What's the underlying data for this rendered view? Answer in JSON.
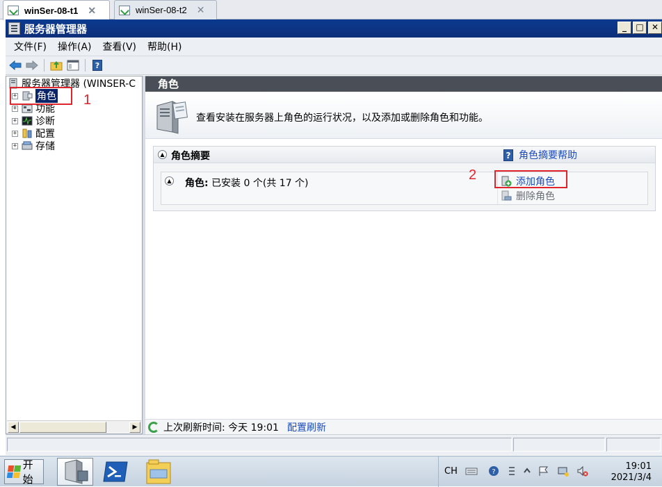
{
  "vm_tabs": [
    {
      "label": "winSer-08-t1",
      "close": "✕"
    },
    {
      "label": "winSer-08-t2",
      "close": "✕"
    }
  ],
  "window": {
    "title": "服务器管理器",
    "buttons": {
      "minimize": "_",
      "maximize": "□",
      "close": "✕"
    }
  },
  "menu": [
    "文件(F)",
    "操作(A)",
    "查看(V)",
    "帮助(H)"
  ],
  "tree": {
    "root": "服务器管理器 (WINSER-C",
    "items": [
      {
        "label": "角色",
        "expander": "+",
        "icon": "roles-icon"
      },
      {
        "label": "功能",
        "expander": "+",
        "icon": "features-icon"
      },
      {
        "label": "诊断",
        "expander": "+",
        "icon": "diagnostics-icon"
      },
      {
        "label": "配置",
        "expander": "+",
        "icon": "configuration-icon"
      },
      {
        "label": "存储",
        "expander": "+",
        "icon": "storage-icon"
      }
    ]
  },
  "pane": {
    "header": "角色",
    "description": "查看安装在服务器上角色的运行状况，以及添加或删除角色和功能。",
    "section_title": "角色摘要",
    "help_link": "角色摘要帮助",
    "roles_label": "角色:",
    "roles_status": "已安装 0 个(共 17 个)",
    "actions": [
      {
        "label": "添加角色",
        "icon": "add-role-icon"
      },
      {
        "label": "删除角色",
        "icon": "remove-role-icon"
      }
    ],
    "refresh_text": "上次刷新时间: 今天 19:01",
    "refresh_link": "配置刷新"
  },
  "annotations": {
    "one": "1",
    "two": "2"
  },
  "taskbar": {
    "start": "开始",
    "language": "CH",
    "time": "19:01",
    "date": "2021/3/4"
  },
  "colors": {
    "title_bar": "#0d2f7a",
    "selection": "#0a246a",
    "annotation": "#e0242c",
    "link": "#1a4bbd"
  }
}
